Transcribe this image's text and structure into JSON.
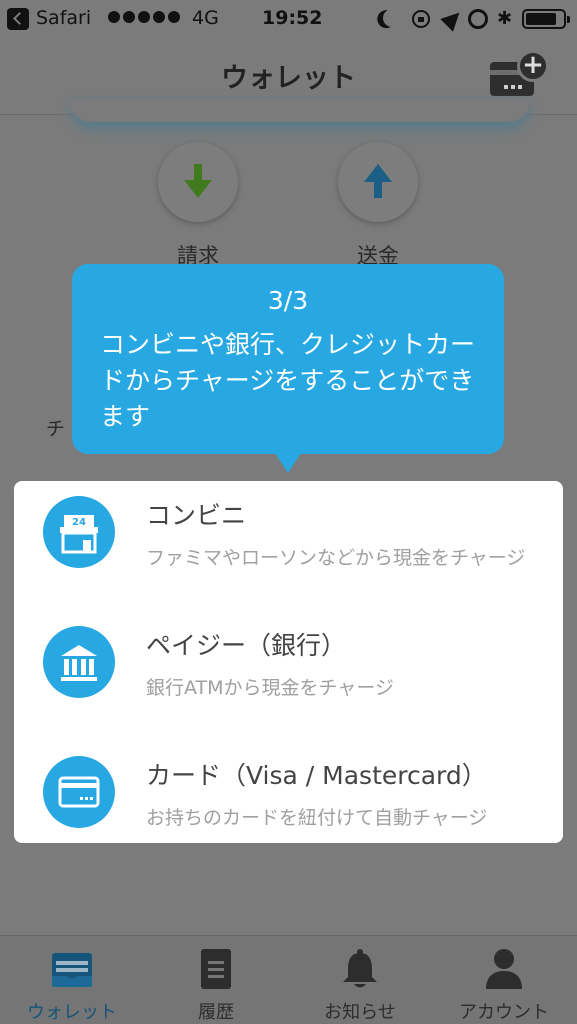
{
  "status_bar": {
    "app": "Safari",
    "network": "4G",
    "time": "19:52"
  },
  "nav": {
    "title": "ウォレット",
    "add_button_icon": "card-add-icon"
  },
  "actions": {
    "request_label": "請求",
    "send_label": "送金",
    "charge_fragment": "チ"
  },
  "tooltip": {
    "step": "3/3",
    "text": "コンビニや銀行、クレジットカードからチャージをすることができます"
  },
  "charge_options": [
    {
      "title": "コンビニ",
      "subtitle": "ファミマやローソンなどから現金をチャージ",
      "icon": "convenience-store-icon"
    },
    {
      "title": "ペイジー（銀行）",
      "subtitle": "銀行ATMから現金をチャージ",
      "icon": "bank-icon"
    },
    {
      "title": "カード（Visa / Mastercard）",
      "subtitle": "お持ちのカードを紐付けて自動チャージ",
      "icon": "credit-card-icon"
    }
  ],
  "tabs": [
    {
      "label": "ウォレット",
      "icon": "wallet-icon",
      "active": true
    },
    {
      "label": "履歴",
      "icon": "history-icon",
      "active": false
    },
    {
      "label": "お知らせ",
      "icon": "bell-icon",
      "active": false
    },
    {
      "label": "アカウント",
      "icon": "account-icon",
      "active": false
    }
  ],
  "colors": {
    "accent": "#27a8e3",
    "overlay_dim": "#7b7b7b",
    "request_arrow": "#3f7a1c",
    "send_arrow": "#1c5f86"
  }
}
